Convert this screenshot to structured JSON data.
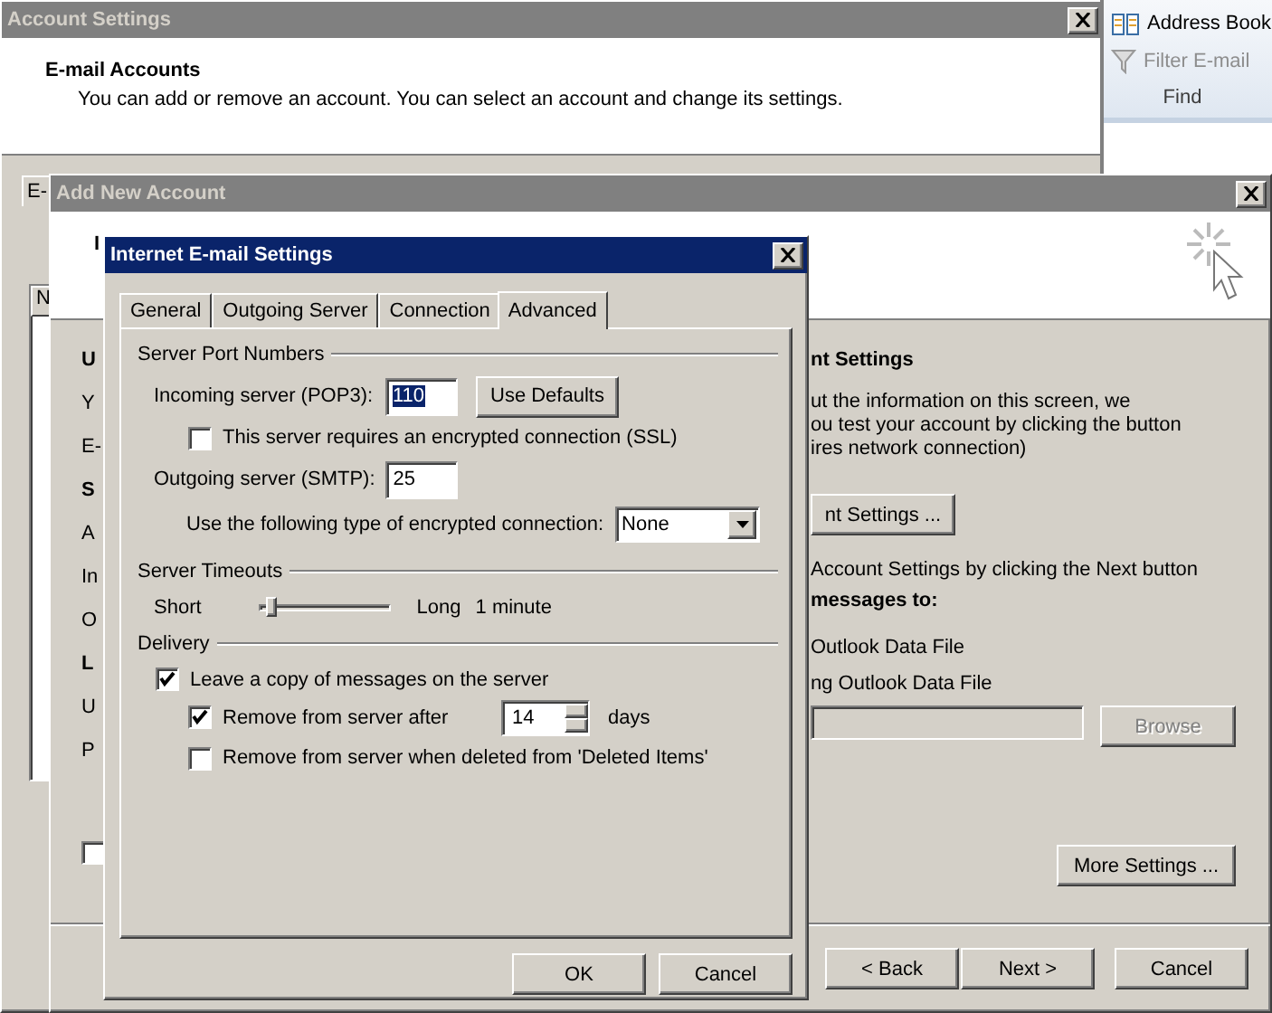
{
  "account_settings": {
    "title": "Account Settings",
    "heading": "E-mail Accounts",
    "description": "You can add or remove an account. You can select an account and change its settings.",
    "tab_fragment": "E-",
    "column_fragment": "N"
  },
  "ribbon": {
    "buttons": [
      {
        "label": "Address Book",
        "disabled": false,
        "kind": "book"
      },
      {
        "label": "Filter E-mail",
        "disabled": true,
        "kind": "filter"
      }
    ],
    "group_label": "Find"
  },
  "add_account": {
    "title": "Add New Account",
    "heading_fragment": "I",
    "left_labels": [
      {
        "text": "U",
        "kind": "heading"
      },
      {
        "text": "Y",
        "kind": "label"
      },
      {
        "text": "E-",
        "kind": "label"
      },
      {
        "text": "S",
        "kind": "heading"
      },
      {
        "text": "A",
        "kind": "label"
      },
      {
        "text": "In",
        "kind": "label"
      },
      {
        "text": "O",
        "kind": "label"
      },
      {
        "text": "L",
        "kind": "heading"
      },
      {
        "text": "U",
        "kind": "label"
      },
      {
        "text": "P",
        "kind": "label"
      }
    ],
    "remember_checkbox": {
      "checked": false
    },
    "right_heading": "nt Settings",
    "right_lines": [
      "ut the information on this screen, we",
      "ou test your account by clicking the button",
      "ires network connection)"
    ],
    "test_button": "nt Settings ...",
    "next_note": "Account Settings by clicking the Next button",
    "deliver_heading": "messages to:",
    "options": [
      "Outlook Data File",
      "ng Outlook Data File"
    ],
    "browse": {
      "label": "Browse",
      "disabled": true
    },
    "more_settings": "More Settings ...",
    "nav_buttons": [
      "< Back",
      "Next >",
      "Cancel"
    ]
  },
  "dialog": {
    "title": "Internet E-mail Settings",
    "tabs": [
      {
        "label": "General",
        "selected": false
      },
      {
        "label": "Outgoing Server",
        "selected": false
      },
      {
        "label": "Connection",
        "selected": false
      },
      {
        "label": "Advanced",
        "selected": true
      }
    ],
    "ports_title": "Server Port Numbers",
    "incoming": {
      "label": "Incoming server (POP3):",
      "value": "110",
      "text_selected": true
    },
    "use_defaults": "Use Defaults",
    "ssl": {
      "label": "This server requires an encrypted connection (SSL)",
      "checked": false
    },
    "outgoing": {
      "label": "Outgoing server (SMTP):",
      "value": "25"
    },
    "encryption": {
      "label": "Use the following type of encrypted connection:",
      "value": "None"
    },
    "timeouts": {
      "title": "Server Timeouts",
      "min_label": "Short",
      "max_label": "Long",
      "level": 0.08,
      "reading": "1 minute"
    },
    "delivery": {
      "title": "Delivery",
      "leave_copy": {
        "label": "Leave a copy of messages on the server",
        "checked": true
      },
      "remove_after": {
        "label": "Remove from server after",
        "checked": true,
        "value": "14",
        "unit": "days"
      },
      "remove_deleted": {
        "label": "Remove from server when deleted from 'Deleted Items'",
        "checked": false
      }
    },
    "buttons": [
      "OK",
      "Cancel"
    ]
  }
}
